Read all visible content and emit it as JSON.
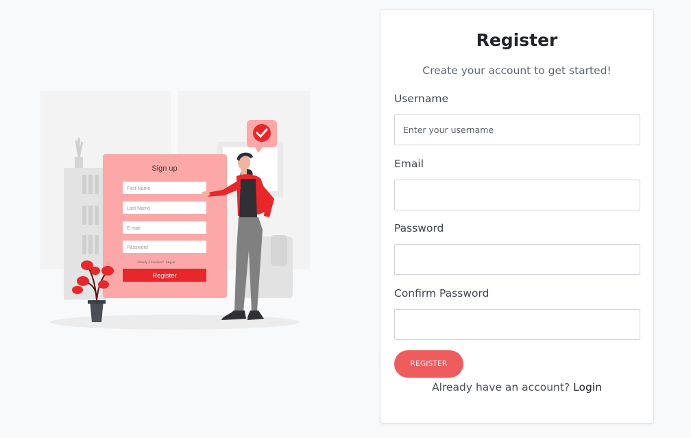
{
  "illustration": {
    "form_title": "Sign up",
    "fields": [
      "First Name",
      "Last Name",
      "E-mail",
      "Password"
    ],
    "footer_text": "Already a member?",
    "footer_link": "Log in",
    "button_label": "Register"
  },
  "form": {
    "title": "Register",
    "subtitle": "Create your account to get started!",
    "username_label": "Username",
    "username_placeholder": "Enter your username",
    "email_label": "Email",
    "password_label": "Password",
    "confirm_password_label": "Confirm Password",
    "register_button": "REGISTER",
    "login_prompt": "Already have an account?",
    "login_link": "Login"
  },
  "colors": {
    "accent": "#ef5c5e",
    "illustration_red": "#e8272b",
    "illustration_pink": "#fca7a8",
    "background": "#f8f9fa"
  }
}
